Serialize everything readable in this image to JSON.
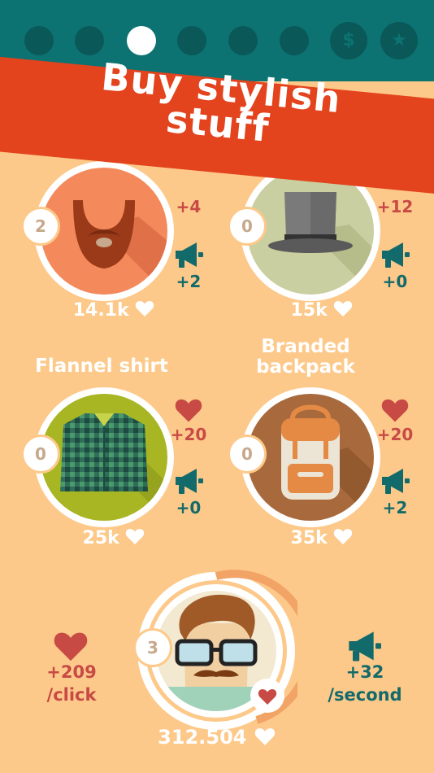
{
  "banner": {
    "line1": "Buy stylish",
    "line2": "stuff"
  },
  "top_nav": {
    "dots": [
      "page-dot-1",
      "page-dot-2",
      "page-dot-3",
      "page-dot-4",
      "page-dot-5",
      "page-dot-6"
    ],
    "active_index": 2,
    "shop_glyph": "$",
    "star_glyph": "★"
  },
  "items": [
    {
      "name": "",
      "count": "2",
      "likes_bonus": "+4",
      "shares_bonus": "+2",
      "price": "14.1k"
    },
    {
      "name": "",
      "count": "0",
      "likes_bonus": "+12",
      "shares_bonus": "+0",
      "price": "15k"
    },
    {
      "name": "Flannel shirt",
      "count": "0",
      "likes_bonus": "+20",
      "shares_bonus": "+0",
      "price": "25k"
    },
    {
      "name": "Branded backpack",
      "name_line1": "Branded",
      "name_line2": "backpack",
      "count": "0",
      "likes_bonus": "+20",
      "shares_bonus": "+2",
      "price": "35k"
    }
  ],
  "player": {
    "level": "3",
    "per_click_value": "+209",
    "per_click_label": "/click",
    "per_second_value": "+32",
    "per_second_label": "/second",
    "total_likes": "312.504"
  },
  "colors": {
    "background": "#fdc98a",
    "top_bar": "#0c7272",
    "ribbon": "#e3431d",
    "heart": "#c74a45",
    "megaphone": "#136a6a"
  }
}
